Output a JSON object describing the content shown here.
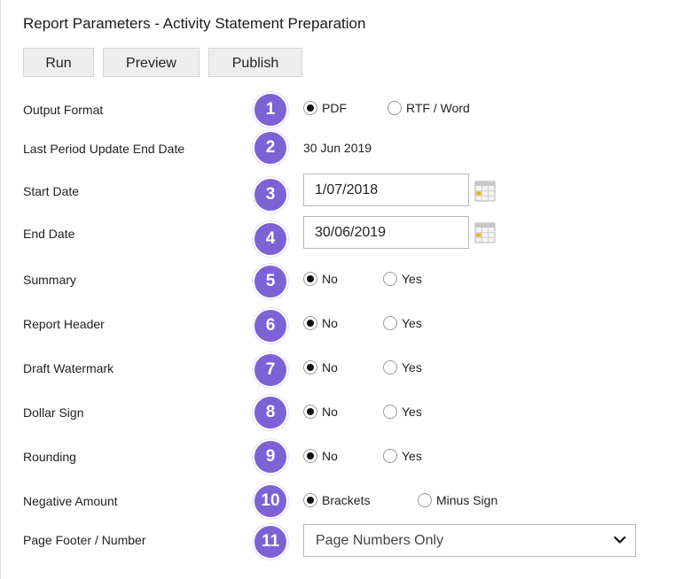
{
  "header": {
    "title": "Report Parameters - Activity Statement Preparation"
  },
  "toolbar": {
    "run_label": "Run",
    "preview_label": "Preview",
    "publish_label": "Publish"
  },
  "rows": {
    "output_format": {
      "label": "Output Format",
      "step": "1",
      "opt1": "PDF",
      "opt2": "RTF / Word",
      "selected": "PDF"
    },
    "last_period": {
      "label": "Last Period Update End Date",
      "step": "2",
      "value": "30 Jun 2019"
    },
    "start_date": {
      "label": "Start Date",
      "step": "3",
      "value": "1/07/2018"
    },
    "end_date": {
      "label": "End Date",
      "step": "4",
      "value": "30/06/2019"
    },
    "summary": {
      "label": "Summary",
      "step": "5",
      "opt1": "No",
      "opt2": "Yes",
      "selected": "No"
    },
    "report_header": {
      "label": "Report Header",
      "step": "6",
      "opt1": "No",
      "opt2": "Yes",
      "selected": "No"
    },
    "draft_watermark": {
      "label": "Draft Watermark",
      "step": "7",
      "opt1": "No",
      "opt2": "Yes",
      "selected": "No"
    },
    "dollar_sign": {
      "label": "Dollar Sign",
      "step": "8",
      "opt1": "No",
      "opt2": "Yes",
      "selected": "No"
    },
    "rounding": {
      "label": "Rounding",
      "step": "9",
      "opt1": "No",
      "opt2": "Yes",
      "selected": "No"
    },
    "negative_amount": {
      "label": "Negative Amount",
      "step": "10",
      "opt1": "Brackets",
      "opt2": "Minus Sign",
      "selected": "Brackets"
    },
    "page_footer": {
      "label": "Page Footer / Number",
      "step": "11",
      "value": "Page Numbers Only"
    }
  },
  "colors": {
    "badge": "#7d62d6",
    "button_bg": "#eeeeee",
    "input_border": "#b8b8b8"
  },
  "icons": {
    "calendar": "calendar-icon",
    "dropdown": "chevron-down-icon"
  }
}
